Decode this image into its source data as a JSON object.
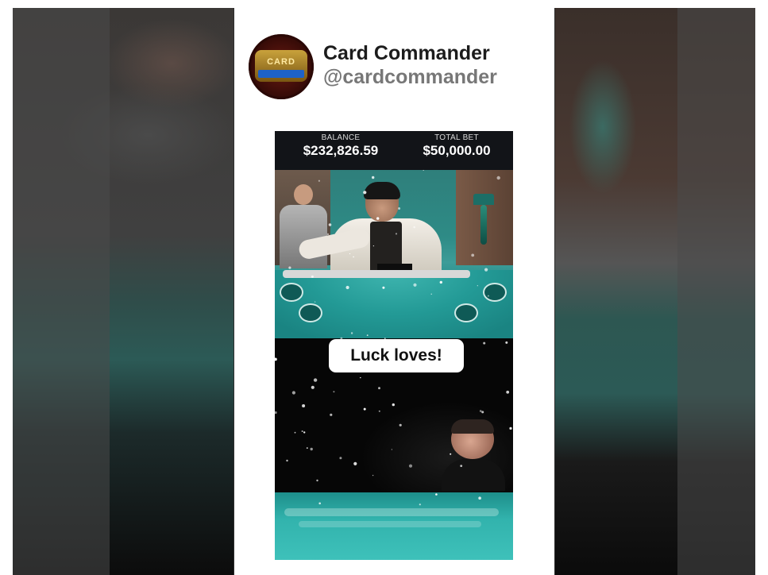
{
  "channel": {
    "name": "Card Commander",
    "handle": "@cardcommander",
    "avatar_text": "CARD"
  },
  "video": {
    "balance_label": "BALANCE",
    "balance_value": "$232,826.59",
    "total_bet_label": "TOTAL BET",
    "total_bet_value": "$50,000.00",
    "caption": "Luck loves!"
  },
  "colors": {
    "table_felt": "#2aa09c",
    "background": "#ffffff",
    "name_text": "#1c1c1c",
    "handle_text": "#777777"
  },
  "icons": [
    "channel-avatar-logo"
  ]
}
